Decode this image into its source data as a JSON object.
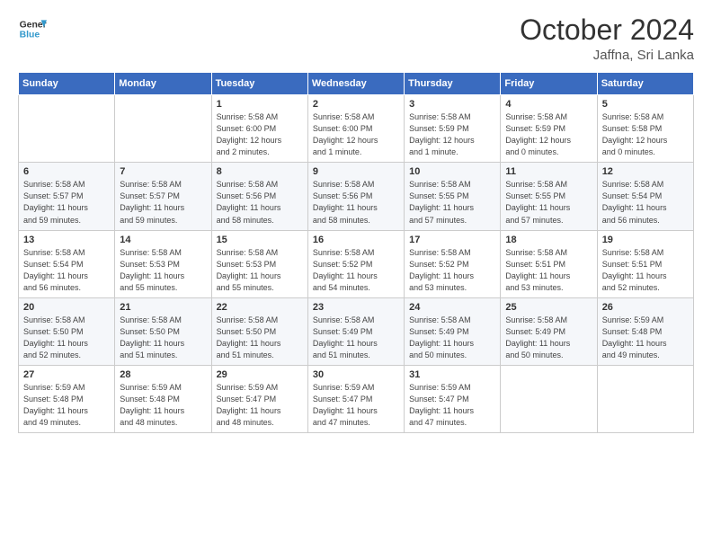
{
  "header": {
    "logo_line1": "General",
    "logo_line2": "Blue",
    "month": "October 2024",
    "location": "Jaffna, Sri Lanka"
  },
  "weekdays": [
    "Sunday",
    "Monday",
    "Tuesday",
    "Wednesday",
    "Thursday",
    "Friday",
    "Saturday"
  ],
  "weeks": [
    [
      {
        "day": "",
        "info": ""
      },
      {
        "day": "",
        "info": ""
      },
      {
        "day": "1",
        "info": "Sunrise: 5:58 AM\nSunset: 6:00 PM\nDaylight: 12 hours\nand 2 minutes."
      },
      {
        "day": "2",
        "info": "Sunrise: 5:58 AM\nSunset: 6:00 PM\nDaylight: 12 hours\nand 1 minute."
      },
      {
        "day": "3",
        "info": "Sunrise: 5:58 AM\nSunset: 5:59 PM\nDaylight: 12 hours\nand 1 minute."
      },
      {
        "day": "4",
        "info": "Sunrise: 5:58 AM\nSunset: 5:59 PM\nDaylight: 12 hours\nand 0 minutes."
      },
      {
        "day": "5",
        "info": "Sunrise: 5:58 AM\nSunset: 5:58 PM\nDaylight: 12 hours\nand 0 minutes."
      }
    ],
    [
      {
        "day": "6",
        "info": "Sunrise: 5:58 AM\nSunset: 5:57 PM\nDaylight: 11 hours\nand 59 minutes."
      },
      {
        "day": "7",
        "info": "Sunrise: 5:58 AM\nSunset: 5:57 PM\nDaylight: 11 hours\nand 59 minutes."
      },
      {
        "day": "8",
        "info": "Sunrise: 5:58 AM\nSunset: 5:56 PM\nDaylight: 11 hours\nand 58 minutes."
      },
      {
        "day": "9",
        "info": "Sunrise: 5:58 AM\nSunset: 5:56 PM\nDaylight: 11 hours\nand 58 minutes."
      },
      {
        "day": "10",
        "info": "Sunrise: 5:58 AM\nSunset: 5:55 PM\nDaylight: 11 hours\nand 57 minutes."
      },
      {
        "day": "11",
        "info": "Sunrise: 5:58 AM\nSunset: 5:55 PM\nDaylight: 11 hours\nand 57 minutes."
      },
      {
        "day": "12",
        "info": "Sunrise: 5:58 AM\nSunset: 5:54 PM\nDaylight: 11 hours\nand 56 minutes."
      }
    ],
    [
      {
        "day": "13",
        "info": "Sunrise: 5:58 AM\nSunset: 5:54 PM\nDaylight: 11 hours\nand 56 minutes."
      },
      {
        "day": "14",
        "info": "Sunrise: 5:58 AM\nSunset: 5:53 PM\nDaylight: 11 hours\nand 55 minutes."
      },
      {
        "day": "15",
        "info": "Sunrise: 5:58 AM\nSunset: 5:53 PM\nDaylight: 11 hours\nand 55 minutes."
      },
      {
        "day": "16",
        "info": "Sunrise: 5:58 AM\nSunset: 5:52 PM\nDaylight: 11 hours\nand 54 minutes."
      },
      {
        "day": "17",
        "info": "Sunrise: 5:58 AM\nSunset: 5:52 PM\nDaylight: 11 hours\nand 53 minutes."
      },
      {
        "day": "18",
        "info": "Sunrise: 5:58 AM\nSunset: 5:51 PM\nDaylight: 11 hours\nand 53 minutes."
      },
      {
        "day": "19",
        "info": "Sunrise: 5:58 AM\nSunset: 5:51 PM\nDaylight: 11 hours\nand 52 minutes."
      }
    ],
    [
      {
        "day": "20",
        "info": "Sunrise: 5:58 AM\nSunset: 5:50 PM\nDaylight: 11 hours\nand 52 minutes."
      },
      {
        "day": "21",
        "info": "Sunrise: 5:58 AM\nSunset: 5:50 PM\nDaylight: 11 hours\nand 51 minutes."
      },
      {
        "day": "22",
        "info": "Sunrise: 5:58 AM\nSunset: 5:50 PM\nDaylight: 11 hours\nand 51 minutes."
      },
      {
        "day": "23",
        "info": "Sunrise: 5:58 AM\nSunset: 5:49 PM\nDaylight: 11 hours\nand 51 minutes."
      },
      {
        "day": "24",
        "info": "Sunrise: 5:58 AM\nSunset: 5:49 PM\nDaylight: 11 hours\nand 50 minutes."
      },
      {
        "day": "25",
        "info": "Sunrise: 5:58 AM\nSunset: 5:49 PM\nDaylight: 11 hours\nand 50 minutes."
      },
      {
        "day": "26",
        "info": "Sunrise: 5:59 AM\nSunset: 5:48 PM\nDaylight: 11 hours\nand 49 minutes."
      }
    ],
    [
      {
        "day": "27",
        "info": "Sunrise: 5:59 AM\nSunset: 5:48 PM\nDaylight: 11 hours\nand 49 minutes."
      },
      {
        "day": "28",
        "info": "Sunrise: 5:59 AM\nSunset: 5:48 PM\nDaylight: 11 hours\nand 48 minutes."
      },
      {
        "day": "29",
        "info": "Sunrise: 5:59 AM\nSunset: 5:47 PM\nDaylight: 11 hours\nand 48 minutes."
      },
      {
        "day": "30",
        "info": "Sunrise: 5:59 AM\nSunset: 5:47 PM\nDaylight: 11 hours\nand 47 minutes."
      },
      {
        "day": "31",
        "info": "Sunrise: 5:59 AM\nSunset: 5:47 PM\nDaylight: 11 hours\nand 47 minutes."
      },
      {
        "day": "",
        "info": ""
      },
      {
        "day": "",
        "info": ""
      }
    ]
  ]
}
